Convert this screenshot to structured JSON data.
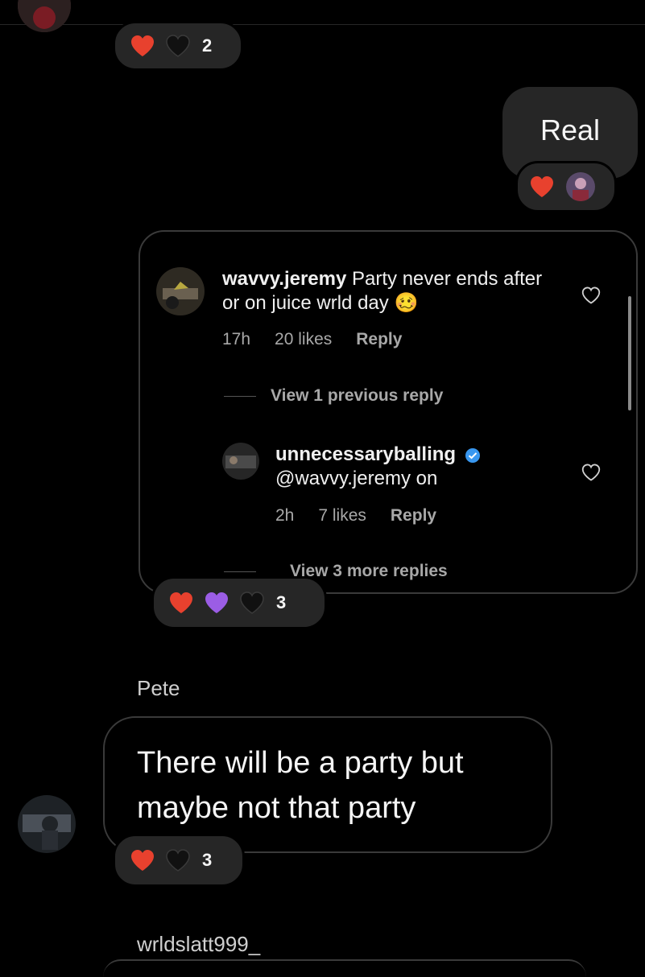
{
  "colors": {
    "background": "#000000",
    "bubble": "#262626",
    "border": "#3a3a3a",
    "muted_text": "#a8a8a8",
    "red_heart": "#e8412e",
    "purple_heart": "#9b5de5",
    "black_heart": "#111111",
    "verified_blue": "#3897f0"
  },
  "top_reactions": {
    "icons": [
      "red-heart-icon",
      "black-heart-icon"
    ],
    "count": "2"
  },
  "outgoing_message": {
    "text": "Real",
    "reactions": {
      "icons": [
        "red-heart-icon",
        "reactor-avatar"
      ]
    }
  },
  "shared_comment": {
    "comment": {
      "username": "wavvy.jeremy",
      "text": "Party never ends after or on juice wrld day",
      "emoji": "🥴",
      "time": "17h",
      "likes": "20 likes",
      "reply_label": "Reply",
      "icon": "heart-outline-icon"
    },
    "view_previous": "View 1 previous reply",
    "reply": {
      "username": "unnecessaryballing",
      "verified_icon": "verified-badge-icon",
      "text": "@wavvy.jeremy on",
      "time": "2h",
      "likes": "7 likes",
      "reply_label": "Reply",
      "icon": "heart-outline-icon"
    },
    "view_more": "View 3 more replies",
    "reactions": {
      "icons": [
        "red-heart-icon",
        "purple-heart-icon",
        "black-heart-icon"
      ],
      "count": "3"
    }
  },
  "incoming_message": {
    "sender": "Pete",
    "line1": "There will be a party but",
    "line2": "maybe not that party",
    "reactions": {
      "icons": [
        "red-heart-icon",
        "black-heart-icon"
      ],
      "count": "3"
    }
  },
  "next_sender": "wrldslatt999_"
}
